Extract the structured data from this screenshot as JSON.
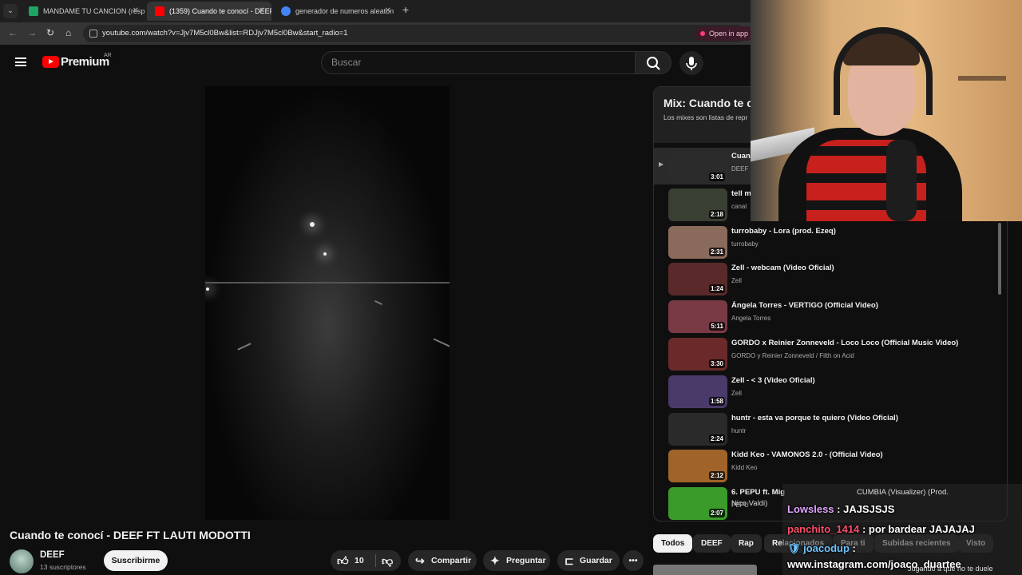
{
  "browser": {
    "tabs": [
      {
        "title": "MANDAME TU CANCION (resp",
        "favicon_color": "#1fa463",
        "active": false
      },
      {
        "title": "(1359) Cuando te conocí - DEEF",
        "favicon_color": "#ff0000",
        "active": true
      },
      {
        "title": "generador de numeros aleaton",
        "favicon_color": "#4285f4",
        "active": false
      }
    ],
    "new_tab": "+",
    "url": "youtube.com/watch?v=Jjv7M5cl0Bw&list=RDJjv7M5cl0Bw&start_radio=1",
    "open_in_app": "Open in app"
  },
  "header": {
    "brand": "Premium",
    "country": "AR",
    "search_placeholder": "Buscar"
  },
  "video": {
    "title": "Cuando te conocí - DEEF FT LAUTI MODOTTI",
    "channel": "DEEF",
    "subscribers": "13 suscriptores",
    "subscribe_label": "Suscribirme",
    "likes": "10",
    "share_label": "Compartir",
    "ask_label": "Preguntar",
    "save_label": "Guardar",
    "more_label": "•••"
  },
  "playlist": {
    "title": "Mix: Cuando te co",
    "subtitle": "Los mixes son listas de repr",
    "items": [
      {
        "title": "Cuan",
        "channel": "DEEF",
        "duration": "3:01",
        "current": true,
        "thumb": "#2b2b2b"
      },
      {
        "title": "tell m",
        "channel": "canal",
        "duration": "2:18",
        "current": false,
        "thumb": "#3a3f33"
      },
      {
        "title": "turrobaby - Lora (prod. Ezeq)",
        "channel": "turrobaby",
        "duration": "2:31",
        "current": false,
        "thumb": "#8a6a5a"
      },
      {
        "title": "Zell - webcam (Video Oficial)",
        "channel": "Zell",
        "duration": "1:24",
        "current": false,
        "thumb": "#5a2a2a"
      },
      {
        "title": "Ángela Torres - VERTIGO (Official Video)",
        "channel": "Angela Torres",
        "duration": "5:11",
        "current": false,
        "thumb": "#7a3a45"
      },
      {
        "title": "GORDO x Reinier Zonneveld - Loco Loco (Official Music Video)",
        "channel": "GORDO y Reinier Zonneveld / Filth on Acid",
        "duration": "3:30",
        "current": false,
        "thumb": "#6a2a2a"
      },
      {
        "title": "Zell -  < 3 (Video Oficial)",
        "channel": "Zell",
        "duration": "1:58",
        "current": false,
        "thumb": "#4a3a6a"
      },
      {
        "title": "huntr - esta va porque te quiero (Video Oficial)",
        "channel": "huntr",
        "duration": "2:24",
        "current": false,
        "thumb": "#2a2a2a"
      },
      {
        "title": "Kidd Keo - VAMONOS 2.0 - (Official Video)",
        "channel": "Kidd Keo",
        "duration": "2:12",
        "current": false,
        "thumb": "#a0632a"
      },
      {
        "title": "6. PEPU ft. Mig",
        "channel": "PEPU",
        "duration": "2:07",
        "current": false,
        "thumb": "#3a9a2a"
      }
    ]
  },
  "chips": [
    "Todos",
    "DEEF",
    "Rap",
    "Relacionados",
    "Para ti",
    "Subidas recientes",
    "Visto"
  ],
  "chat": {
    "faint_top": "CUMBIA (Visualizer) (Prod.",
    "faint_top2": "Nico Valdi)",
    "messages": [
      {
        "user": "Lowsless",
        "text": " : JAJSJSJS"
      },
      {
        "user": "panchito_1414",
        "text": " : por bardear JAJAJAJ"
      },
      {
        "user": "joacodup",
        "text": " :"
      }
    ],
    "link": "www.instagram.com/joaco_duartee",
    "faint_bottom": "Jugando a que no te duele"
  }
}
